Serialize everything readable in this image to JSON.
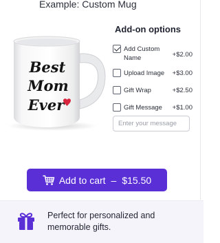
{
  "product": {
    "example_title": "Example: Custom Mug",
    "mug_text_line1": "Best",
    "mug_text_line2": "Mom",
    "mug_text_line3": "Ever"
  },
  "addons": {
    "heading": "Add-on options",
    "options": [
      {
        "label": "Add Custom Name",
        "price": "+$2.00",
        "checked": true
      },
      {
        "label": "Upload Image",
        "price": "+$3.00",
        "checked": false
      },
      {
        "label": "Gift Wrap",
        "price": "+$2.50",
        "checked": false
      },
      {
        "label": "Gift Message",
        "price": "+$1.00",
        "checked": false
      }
    ],
    "message_placeholder": "Enter your message",
    "message_value": ""
  },
  "cart": {
    "label": "Add to cart",
    "separator": "–",
    "total": "$15.50",
    "icon": "cart-icon"
  },
  "promo": {
    "icon": "gift-icon",
    "text": "Perfect for personalized and memorable gifts."
  },
  "colors": {
    "accent": "#5b2fd6",
    "heart": "#d7263d",
    "promo_background": "#f6f4fb"
  }
}
